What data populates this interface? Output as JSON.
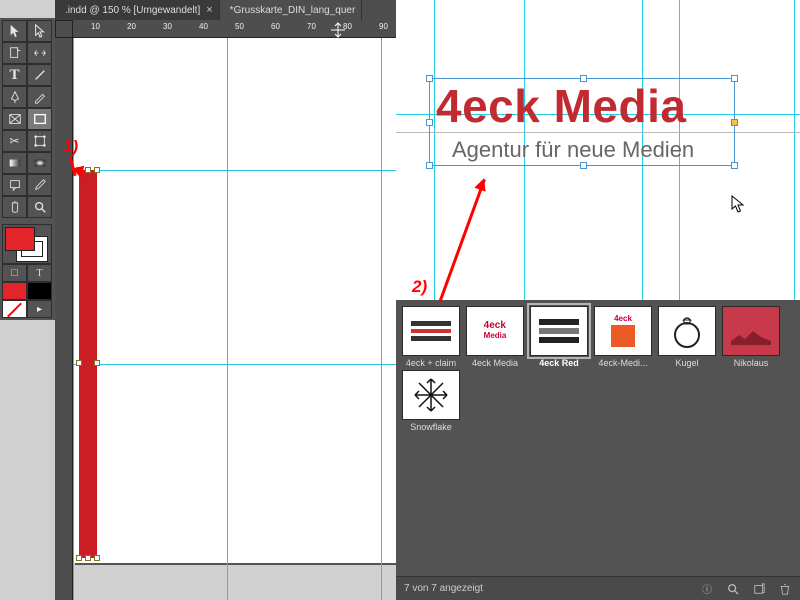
{
  "tabs": [
    {
      "label": ".indd @ 150 % [Umgewandelt]",
      "active": true
    },
    {
      "label": "*Grusskarte_DIN_lang_quer",
      "active": false
    }
  ],
  "ruler_ticks": [
    "10",
    "20",
    "30",
    "40",
    "50",
    "60",
    "70",
    "80",
    "90"
  ],
  "tools": {
    "selection": "selection-tool",
    "direct": "direct-selection-tool",
    "page": "page-tool",
    "gap": "gap-tool",
    "type": "type-tool",
    "line": "line-tool",
    "pen": "pen-tool",
    "pencil": "pencil-tool",
    "rect_frame": "rect-frame-tool",
    "rect": "rectangle-tool",
    "scissors": "scissors-tool",
    "transform": "free-transform-tool",
    "gradient_sw": "gradient-swatch-tool",
    "gradient_feather": "gradient-feather-tool",
    "note": "note-tool",
    "eyedrop": "eyedropper-tool",
    "hand": "hand-tool",
    "zoom": "zoom-tool"
  },
  "bottom_tools": {
    "fill_mode": "□",
    "text_mode": "T"
  },
  "colors": {
    "fill": "#e3252b",
    "stroke": "#ffffff",
    "red": "#cb1d24"
  },
  "annotations": {
    "one": "1)",
    "two": "2)"
  },
  "logo": {
    "title": "4eck Media",
    "sub": "Agentur für neue Medien"
  },
  "library": {
    "items": [
      {
        "name": "4eck + claim",
        "thumb": "claim"
      },
      {
        "name": "4eck Media",
        "thumb": "4eck"
      },
      {
        "name": "4eck Red",
        "thumb": "redbars",
        "selected": true
      },
      {
        "name": "4eck-Medi...",
        "thumb": "redbox"
      },
      {
        "name": "Kugel",
        "thumb": "ornament"
      },
      {
        "name": "Nikolaus",
        "thumb": "nikolaus"
      },
      {
        "name": "Snowflake",
        "thumb": "snowflake"
      }
    ],
    "status": "7 von 7 angezeigt"
  }
}
